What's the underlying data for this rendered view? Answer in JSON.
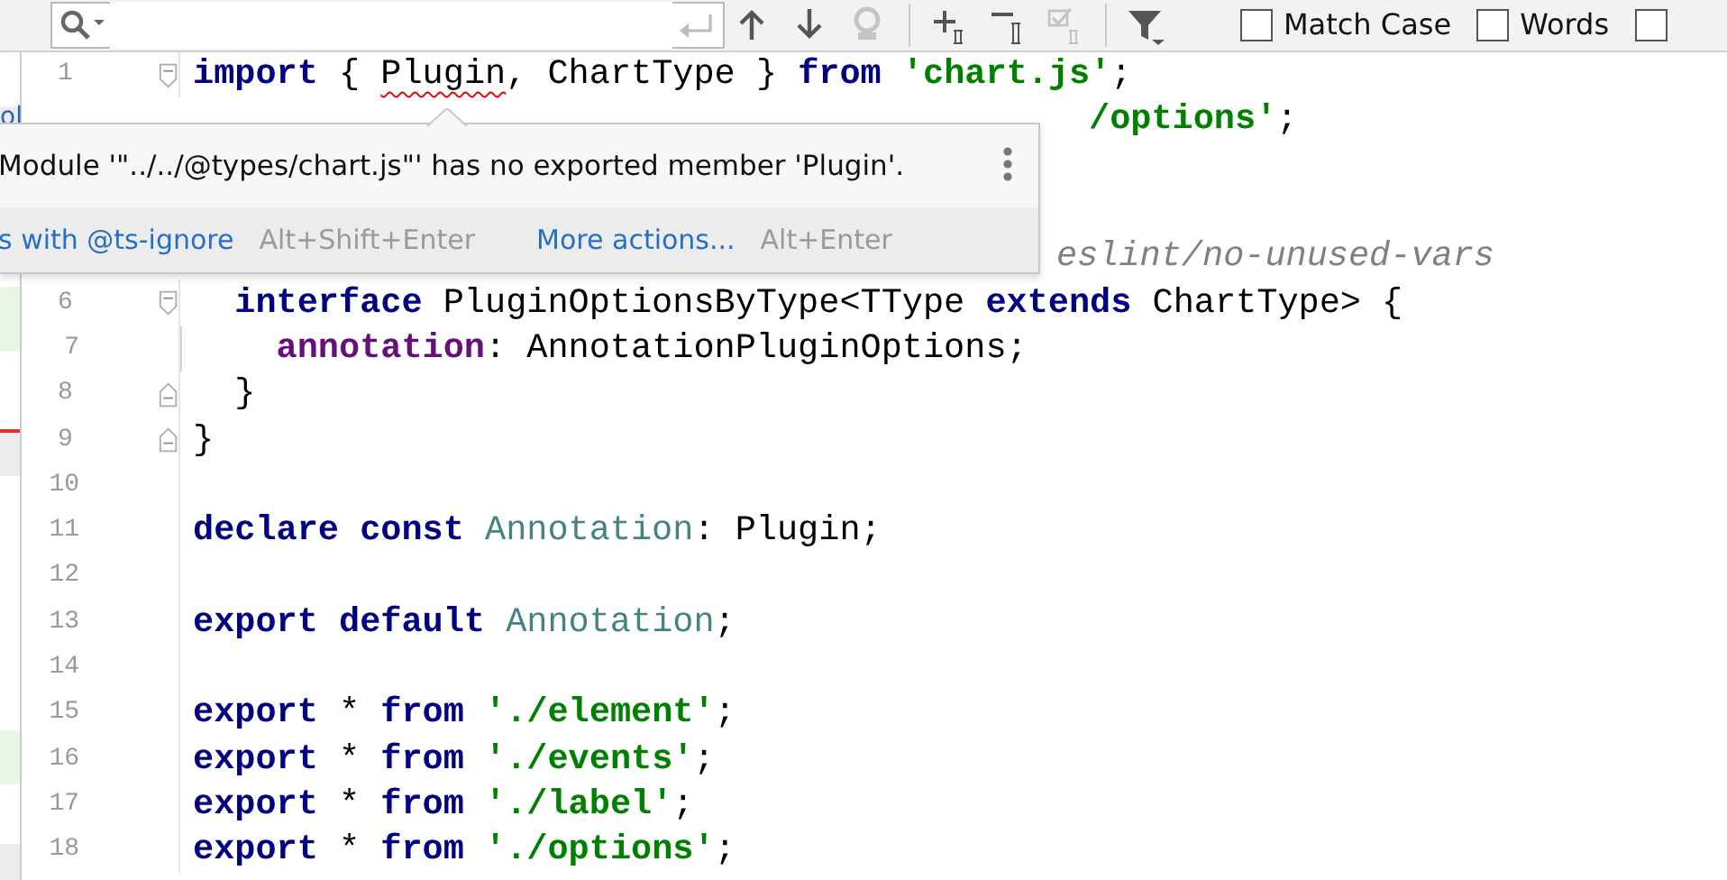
{
  "search_bar": {
    "buttons": [
      {
        "kind": "up",
        "disabled": false
      },
      {
        "kind": "down",
        "disabled": false
      },
      {
        "kind": "stamp",
        "disabled": true
      },
      {
        "kind": "add",
        "disabled": false
      },
      {
        "kind": "remove",
        "disabled": false
      },
      {
        "kind": "select",
        "disabled": true
      },
      {
        "kind": "filter",
        "disabled": false
      }
    ],
    "options": [
      {
        "label": "Match Case",
        "checked": false
      },
      {
        "label": "Words",
        "checked": false
      },
      {
        "checked": false
      }
    ]
  },
  "side_panel": {
    "text": "ol"
  },
  "editor": {
    "lines": [
      {
        "kind": "code",
        "number": "1",
        "fold_open": true,
        "tokens": [
          {
            "kind": "keyword",
            "text": "import"
          },
          {
            "kind": "plain",
            "text": " { "
          },
          {
            "kind": "plain",
            "text": "Plugin",
            "error": true
          },
          {
            "kind": "plain",
            "text": ", ChartType } "
          },
          {
            "kind": "keyword",
            "text": "from"
          },
          {
            "kind": "string",
            "text": " 'chart.js'"
          },
          {
            "kind": "plain",
            "text": ";"
          }
        ]
      },
      {
        "kind": "fragment",
        "tokens": [
          {
            "kind": "string",
            "text": "/options'"
          },
          {
            "kind": "plain",
            "text": ";"
          }
        ]
      },
      {
        "kind": "hidden"
      },
      {
        "kind": "hidden"
      },
      {
        "kind": "fragment",
        "tokens": [
          {
            "kind": "comment",
            "text": "eslint/no-unused-vars"
          }
        ]
      },
      {
        "kind": "code",
        "number": "6",
        "fold_open": true,
        "tokens": [
          {
            "kind": "keyword",
            "text": "  interface"
          },
          {
            "kind": "plain",
            "text": " PluginOptionsByType<TType "
          },
          {
            "kind": "keyword",
            "text": "extends"
          },
          {
            "kind": "plain",
            "text": " ChartType> {"
          }
        ]
      },
      {
        "kind": "code",
        "number": "7",
        "indent_guide": true,
        "tokens": [
          {
            "kind": "property",
            "text": "    annotation"
          },
          {
            "kind": "plain",
            "text": ": AnnotationPluginOptions;"
          }
        ]
      },
      {
        "kind": "code",
        "number": "8",
        "fold_close": true,
        "tokens": [
          {
            "kind": "plain",
            "text": "  }"
          }
        ]
      },
      {
        "kind": "code",
        "number": "9",
        "fold_close": true,
        "tokens": [
          {
            "kind": "plain",
            "text": "}"
          }
        ]
      },
      {
        "kind": "code",
        "number": "10"
      },
      {
        "kind": "code",
        "number": "11",
        "tokens": [
          {
            "kind": "keyword",
            "text": "declare const"
          },
          {
            "kind": "constant",
            "text": " Annotation"
          },
          {
            "kind": "plain",
            "text": ": Plugin;"
          }
        ]
      },
      {
        "kind": "code",
        "number": "12"
      },
      {
        "kind": "code",
        "number": "13",
        "tokens": [
          {
            "kind": "keyword",
            "text": "export default"
          },
          {
            "kind": "constant",
            "text": " Annotation"
          },
          {
            "kind": "plain",
            "text": ";"
          }
        ]
      },
      {
        "kind": "code",
        "number": "14"
      },
      {
        "kind": "code",
        "number": "15",
        "tokens": [
          {
            "kind": "keyword",
            "text": "export"
          },
          {
            "kind": "plain",
            "text": " * "
          },
          {
            "kind": "keyword",
            "text": "from"
          },
          {
            "kind": "string",
            "text": " './element'"
          },
          {
            "kind": "plain",
            "text": ";"
          }
        ]
      },
      {
        "kind": "code",
        "number": "16",
        "tokens": [
          {
            "kind": "keyword",
            "text": "export"
          },
          {
            "kind": "plain",
            "text": " * "
          },
          {
            "kind": "keyword",
            "text": "from"
          },
          {
            "kind": "string",
            "text": " './events'"
          },
          {
            "kind": "plain",
            "text": ";"
          }
        ]
      },
      {
        "kind": "code",
        "number": "17",
        "tokens": [
          {
            "kind": "keyword",
            "text": "export"
          },
          {
            "kind": "plain",
            "text": " * "
          },
          {
            "kind": "keyword",
            "text": "from"
          },
          {
            "kind": "string",
            "text": " './label'"
          },
          {
            "kind": "plain",
            "text": ";"
          }
        ]
      },
      {
        "kind": "code",
        "number": "18",
        "tokens": [
          {
            "kind": "keyword",
            "text": "export"
          },
          {
            "kind": "plain",
            "text": " * "
          },
          {
            "kind": "keyword",
            "text": "from"
          },
          {
            "kind": "string",
            "text": " './options'"
          },
          {
            "kind": "plain",
            "text": ";"
          }
        ]
      }
    ]
  },
  "popup": {
    "message": "Module '\"../../@types/chart.js\"' has no exported member 'Plugin'.",
    "actions": [
      {
        "kind": "link",
        "text": "s with @ts-ignore"
      },
      {
        "kind": "shortcut",
        "text": "Alt+Shift+Enter"
      },
      {
        "kind": "link",
        "text": "More actions..."
      },
      {
        "kind": "shortcut",
        "text": "Alt+Enter"
      }
    ]
  }
}
